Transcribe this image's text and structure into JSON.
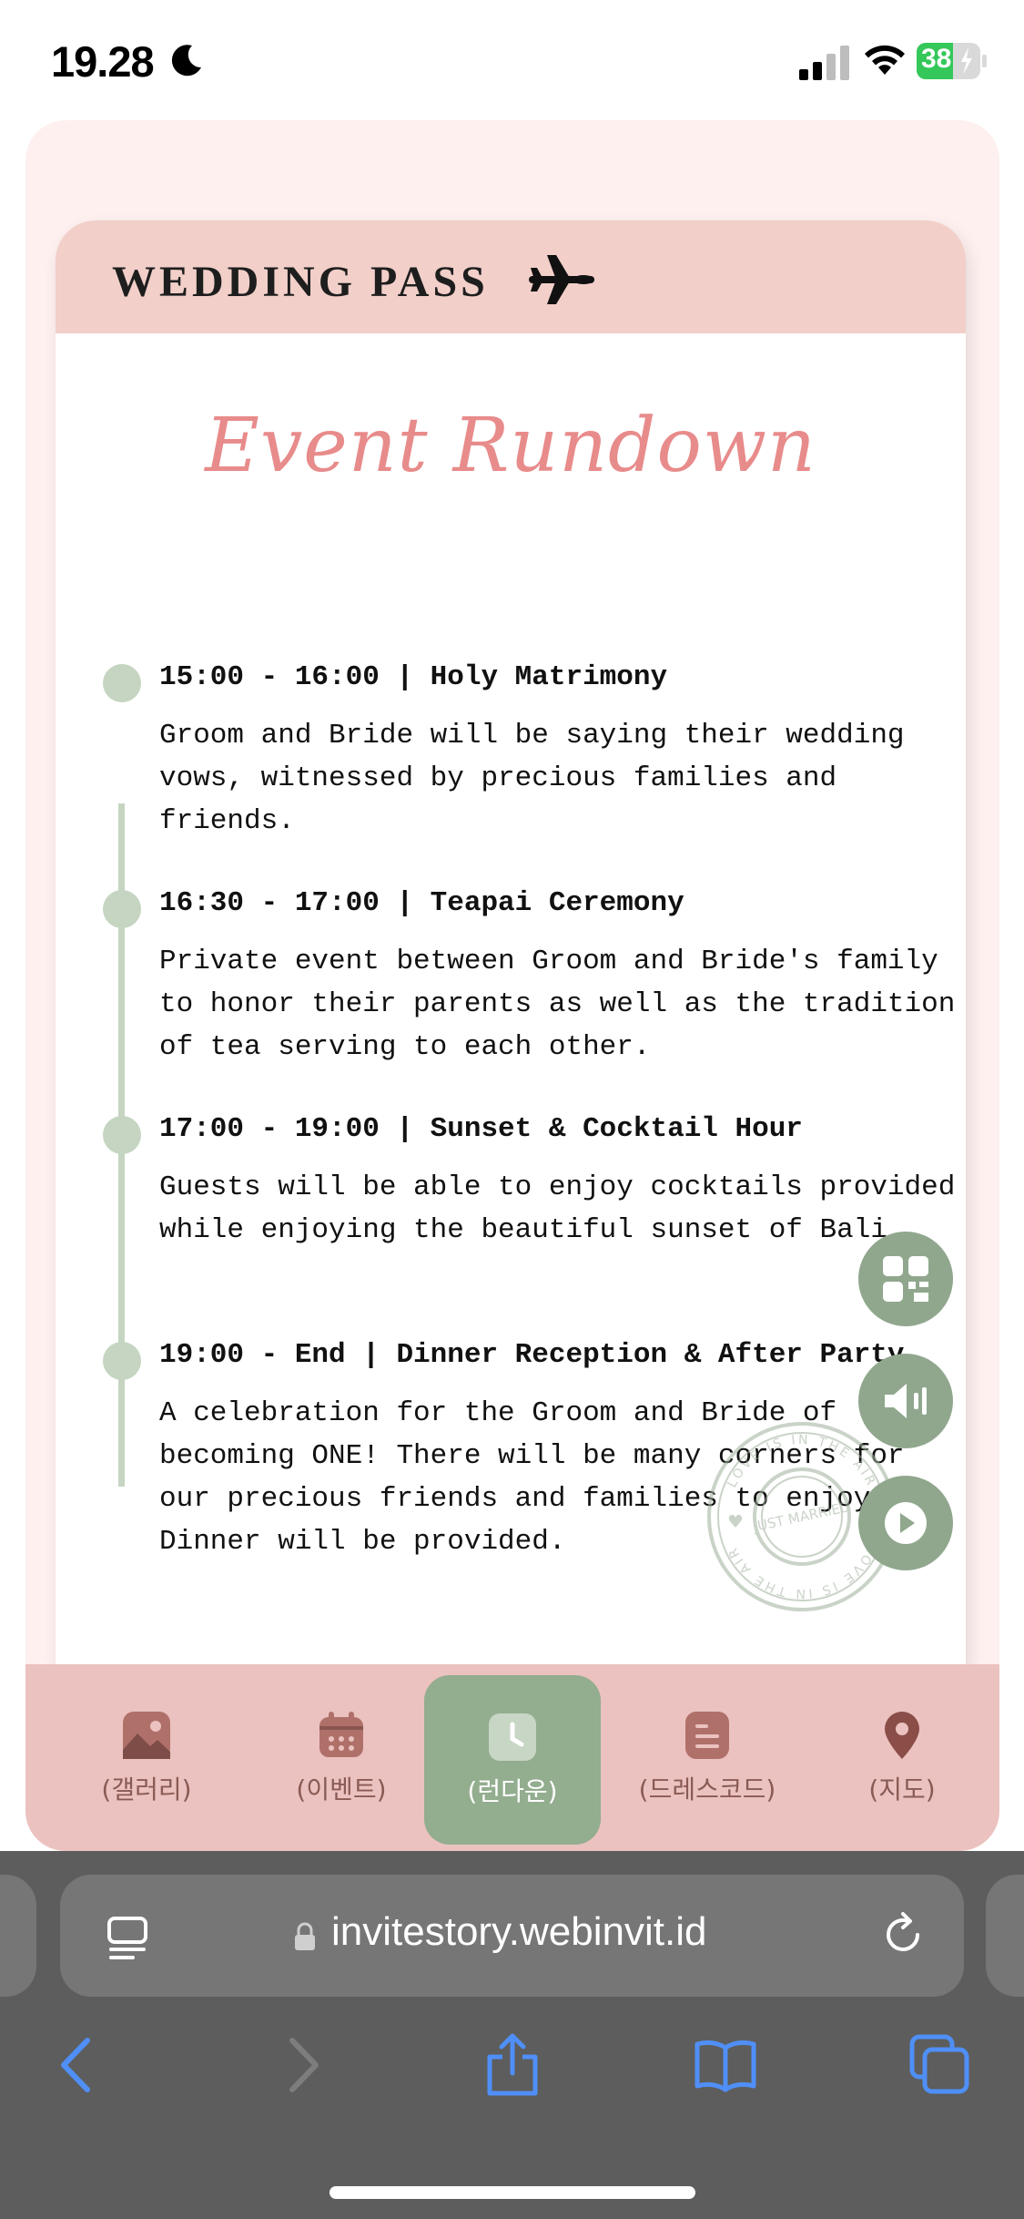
{
  "status_bar": {
    "time": "19.28",
    "battery": "38"
  },
  "pass": {
    "title": "WEDDING PASS",
    "section_title": "Event Rundown"
  },
  "events": [
    {
      "heading": "15:00 - 16:00 | Holy Matrimony",
      "description": "Groom and Bride will be saying their wedding vows, witnessed by precious families and friends."
    },
    {
      "heading": "16:30 - 17:00 | Teapai Ceremony",
      "description": "Private event between Groom and Bride's family to honor their parents as well as the tradition of tea serving to each other."
    },
    {
      "heading": "17:00 - 19:00 | Sunset & Cocktail Hour",
      "description": "Guests will be able to enjoy cocktails provided while enjoying the beautiful sunset of Bali."
    },
    {
      "heading": "19:00 - End | Dinner Reception & After Party",
      "description": "A celebration for the Groom and Bride of becoming ONE! There will be many corners for our precious friends and families to enjoy. Dinner will be provided."
    }
  ],
  "stamp": {
    "ring_text": "LOVE IS IN THE AIR",
    "center_text": "JUST MARRIED"
  },
  "nav": {
    "items": [
      {
        "label": "(갤러리)",
        "icon": "gallery-icon"
      },
      {
        "label": "(이벤트)",
        "icon": "calendar-icon"
      },
      {
        "label": "(런다운)",
        "icon": "clock-icon"
      },
      {
        "label": "(드레스코드)",
        "icon": "document-icon"
      },
      {
        "label": "(지도)",
        "icon": "map-pin-icon"
      }
    ],
    "active_index": 2
  },
  "browser": {
    "url": "invitestory.webinvit.id"
  },
  "colors": {
    "accent_pink": "#e88b8b",
    "header_pink": "#f2cfc9",
    "sage": "#93ad8f",
    "nav_bg": "#ebc2bf"
  }
}
